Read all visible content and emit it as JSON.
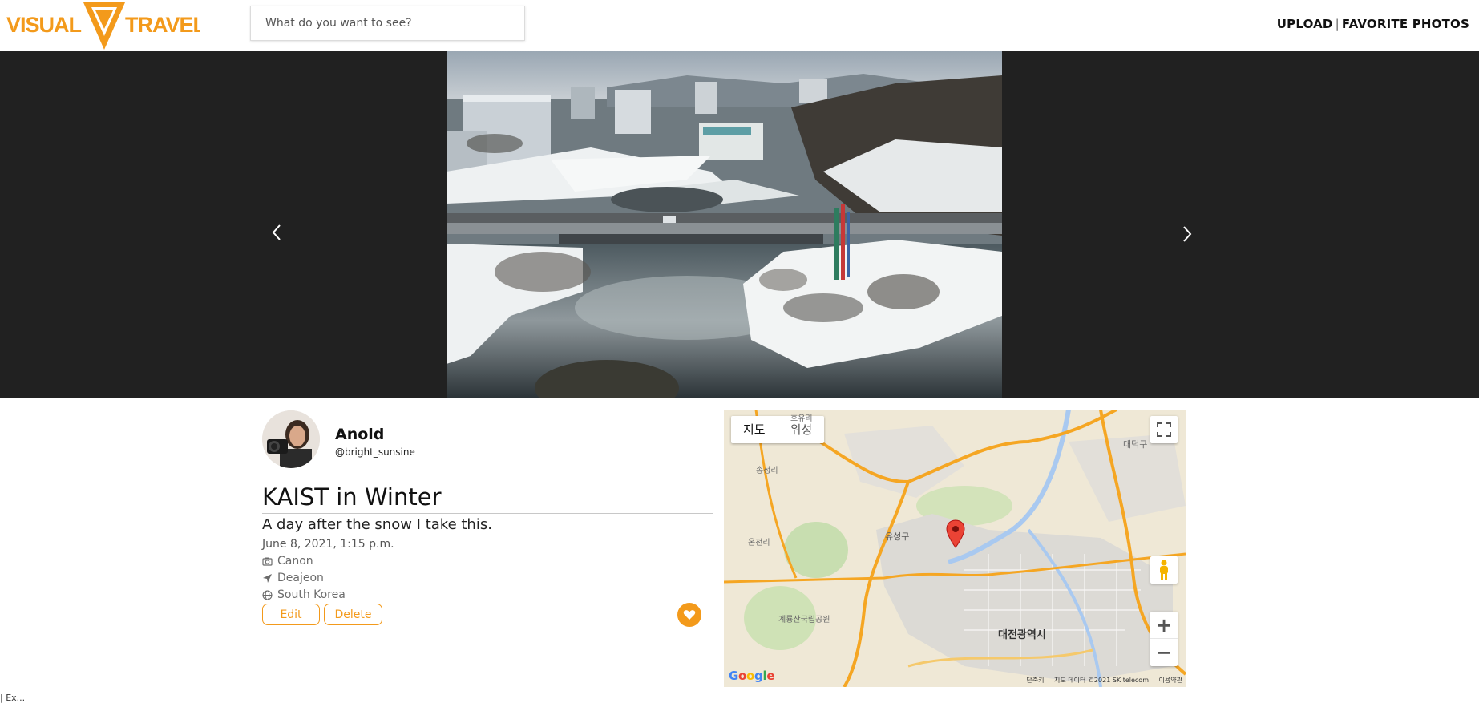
{
  "header": {
    "logo_left": "VISUAL",
    "logo_right": "TRAVEL",
    "search_placeholder": "What do you want to see?",
    "nav_upload": "UPLOAD",
    "nav_separator": "|",
    "nav_favorites": "FAVORITE PHOTOS"
  },
  "colors": {
    "accent": "#f39a1b",
    "carousel_bg": "#212121"
  },
  "carousel": {
    "prev_icon": "chevron-left-icon",
    "next_icon": "chevron-right-icon"
  },
  "author": {
    "name": "Anold",
    "handle": "@bright_sunsine"
  },
  "post": {
    "title": "KAIST in Winter",
    "description": "A day after the snow I take this.",
    "date": "June 8, 2021, 1:15 p.m.",
    "camera": "Canon",
    "city": "Deajeon",
    "country": "South Korea",
    "edit_label": "Edit",
    "delete_label": "Delete",
    "like_icon": "heart-icon"
  },
  "map": {
    "type_map": "지도",
    "type_satellite": "위성",
    "zoom_in": "+",
    "zoom_out": "−",
    "labels": {
      "city": "대전광역시",
      "district": "유성구",
      "daedeok": "대덕구",
      "park": "계룡산국립공원",
      "north": "호유리",
      "west1": "송정리",
      "west2": "온천리"
    },
    "attribution_shortcuts": "단축키",
    "attribution_data": "지도 데이터 ©2021 SK telecom",
    "attribution_terms": "이용약관",
    "google": [
      "G",
      "o",
      "o",
      "g",
      "l",
      "e"
    ]
  },
  "footer": {
    "text": "| Ex..."
  }
}
